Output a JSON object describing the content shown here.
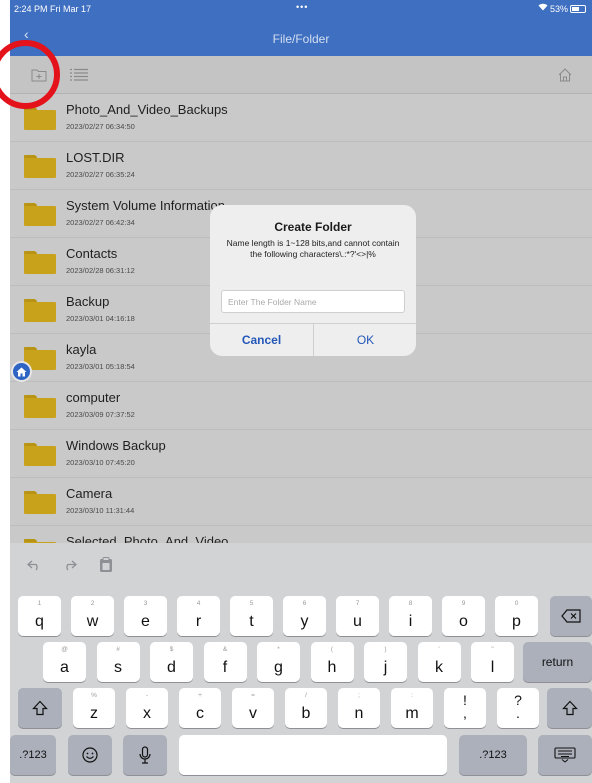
{
  "status_bar": {
    "time": "2:24 PM  Fri Mar 17",
    "dots": "•••",
    "battery": "53%"
  },
  "nav": {
    "back": "‹",
    "title": "File/Folder"
  },
  "toolbar": {
    "new_folder_icon": "new-folder-icon",
    "list_view_icon": "list-view-icon",
    "home_icon": "home-icon"
  },
  "files": [
    {
      "name": "Photo_And_Video_Backups",
      "date": "2023/02/27 06:34:50"
    },
    {
      "name": "LOST.DIR",
      "date": "2023/02/27 06:35:24"
    },
    {
      "name": "System Volume Information",
      "date": "2023/02/27 06:42:34"
    },
    {
      "name": "Contacts",
      "date": "2023/02/28 06:31:12"
    },
    {
      "name": "Backup",
      "date": "2023/03/01 04:16:18"
    },
    {
      "name": "kayla",
      "date": "2023/03/01 05:18:54"
    },
    {
      "name": "computer",
      "date": "2023/03/09 07:37:52"
    },
    {
      "name": "Windows Backup",
      "date": "2023/03/10 07:45:20"
    },
    {
      "name": "Camera",
      "date": "2023/03/10 11:31:44"
    },
    {
      "name": "Selected_Photo_And_Video",
      "date": ""
    }
  ],
  "dialog": {
    "title": "Create Folder",
    "message": "Name length is 1~128 bits,and cannot contain the following characters\\.:*?'<>|%",
    "placeholder": "Enter The Folder Name",
    "cancel": "Cancel",
    "ok": "OK"
  },
  "keyboard": {
    "row1": [
      {
        "hint": "1",
        "key": "q"
      },
      {
        "hint": "2",
        "key": "w"
      },
      {
        "hint": "3",
        "key": "e"
      },
      {
        "hint": "4",
        "key": "r"
      },
      {
        "hint": "5",
        "key": "t"
      },
      {
        "hint": "6",
        "key": "y"
      },
      {
        "hint": "7",
        "key": "u"
      },
      {
        "hint": "8",
        "key": "i"
      },
      {
        "hint": "9",
        "key": "o"
      },
      {
        "hint": "0",
        "key": "p"
      }
    ],
    "row2": [
      {
        "hint": "@",
        "key": "a"
      },
      {
        "hint": "#",
        "key": "s"
      },
      {
        "hint": "$",
        "key": "d"
      },
      {
        "hint": "&",
        "key": "f"
      },
      {
        "hint": "*",
        "key": "g"
      },
      {
        "hint": "(",
        "key": "h"
      },
      {
        "hint": ")",
        "key": "j"
      },
      {
        "hint": "'",
        "key": "k"
      },
      {
        "hint": "\"",
        "key": "l"
      }
    ],
    "row3": [
      {
        "hint": "%",
        "key": "z"
      },
      {
        "hint": "-",
        "key": "x"
      },
      {
        "hint": "+",
        "key": "c"
      },
      {
        "hint": "=",
        "key": "v"
      },
      {
        "hint": "/",
        "key": "b"
      },
      {
        "hint": ";",
        "key": "n"
      },
      {
        "hint": ":",
        "key": "m"
      },
      {
        "hint": "",
        "key": "!\n,"
      },
      {
        "hint": "",
        "key": "?\n."
      }
    ],
    "return": "return",
    "numbers_left": ".?123",
    "numbers_right": ".?123"
  },
  "colors": {
    "accent": "#3f6fc0",
    "folder": "#c9a21c",
    "highlight_ring": "#e3121b",
    "link": "#2458b8"
  }
}
